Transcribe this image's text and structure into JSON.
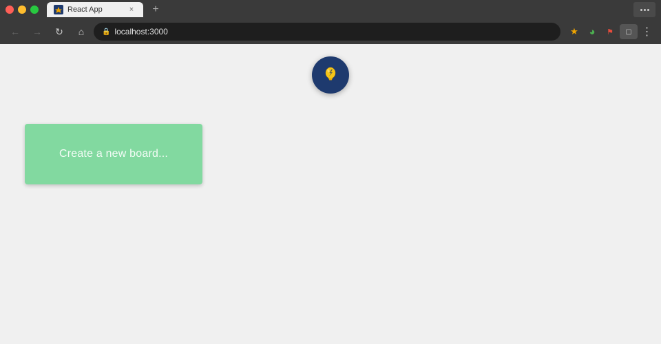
{
  "browser": {
    "tab": {
      "title": "React App",
      "favicon": "⚡"
    },
    "address": "localhost:3000",
    "controls": {
      "close": "×",
      "minimize": "−",
      "maximize": "+"
    }
  },
  "page": {
    "app_icon_label": "React App icon",
    "create_board_text": "Create a new board...",
    "background_color": "#f0f0f0",
    "card_color": "#82d9a0"
  }
}
